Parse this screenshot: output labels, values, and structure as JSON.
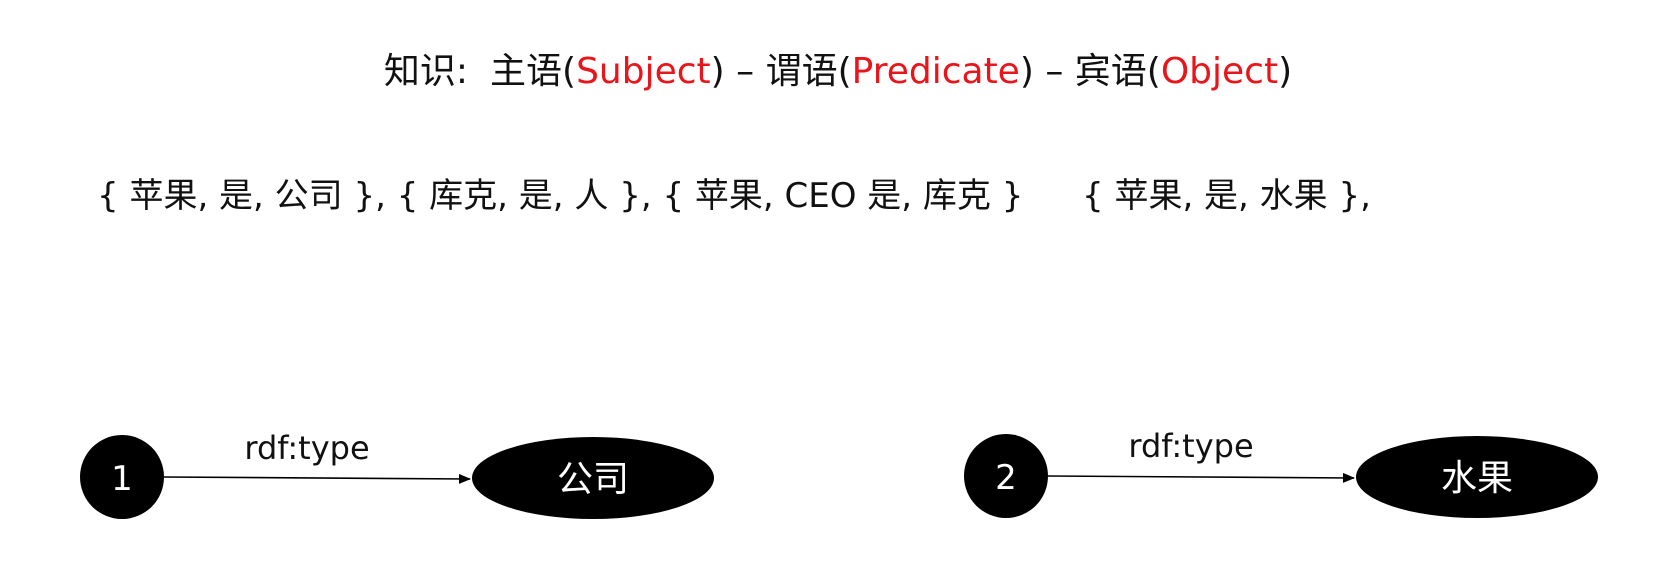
{
  "title": {
    "prefix": "知识:",
    "subject_cn": "主语(",
    "subject_en": "Subject",
    "sep1": ") – 谓语(",
    "predicate_en": "Predicate",
    "sep2": ") – 宾语(",
    "object_en": "Object",
    "close": ")"
  },
  "triples": {
    "left": "{ 苹果, 是, 公司 }, { 库克, 是, 人 }, { 苹果, CEO 是, 库克 }",
    "right": "{ 苹果, 是, 水果 },"
  },
  "graphs": [
    {
      "node": "1",
      "edge": "rdf:type",
      "target": "公司"
    },
    {
      "node": "2",
      "edge": "rdf:type",
      "target": "水果"
    }
  ],
  "colors": {
    "accent_red": "#e8161b",
    "node_fill": "#000000",
    "node_text": "#ffffff"
  }
}
